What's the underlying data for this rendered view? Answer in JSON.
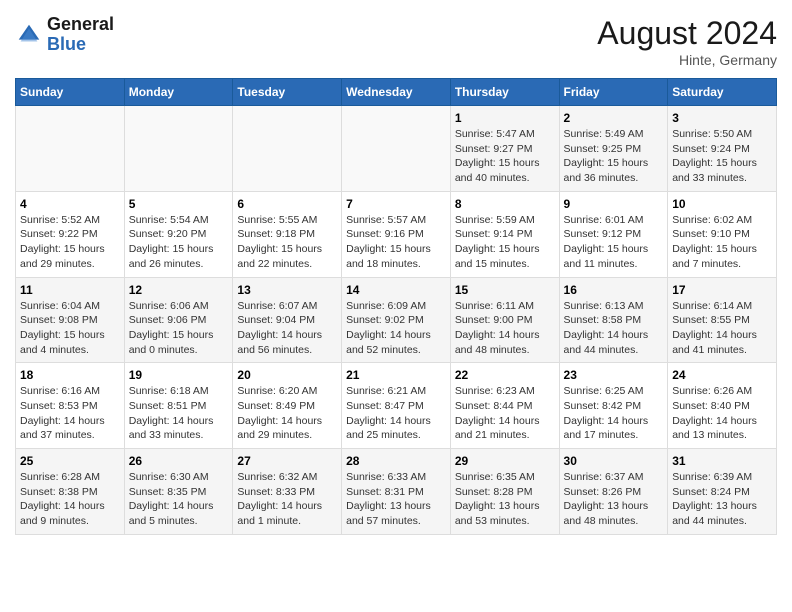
{
  "header": {
    "logo_general": "General",
    "logo_blue": "Blue",
    "month_year": "August 2024",
    "location": "Hinte, Germany"
  },
  "weekdays": [
    "Sunday",
    "Monday",
    "Tuesday",
    "Wednesday",
    "Thursday",
    "Friday",
    "Saturday"
  ],
  "weeks": [
    [
      {
        "day": "",
        "info": ""
      },
      {
        "day": "",
        "info": ""
      },
      {
        "day": "",
        "info": ""
      },
      {
        "day": "",
        "info": ""
      },
      {
        "day": "1",
        "info": "Sunrise: 5:47 AM\nSunset: 9:27 PM\nDaylight: 15 hours\nand 40 minutes."
      },
      {
        "day": "2",
        "info": "Sunrise: 5:49 AM\nSunset: 9:25 PM\nDaylight: 15 hours\nand 36 minutes."
      },
      {
        "day": "3",
        "info": "Sunrise: 5:50 AM\nSunset: 9:24 PM\nDaylight: 15 hours\nand 33 minutes."
      }
    ],
    [
      {
        "day": "4",
        "info": "Sunrise: 5:52 AM\nSunset: 9:22 PM\nDaylight: 15 hours\nand 29 minutes."
      },
      {
        "day": "5",
        "info": "Sunrise: 5:54 AM\nSunset: 9:20 PM\nDaylight: 15 hours\nand 26 minutes."
      },
      {
        "day": "6",
        "info": "Sunrise: 5:55 AM\nSunset: 9:18 PM\nDaylight: 15 hours\nand 22 minutes."
      },
      {
        "day": "7",
        "info": "Sunrise: 5:57 AM\nSunset: 9:16 PM\nDaylight: 15 hours\nand 18 minutes."
      },
      {
        "day": "8",
        "info": "Sunrise: 5:59 AM\nSunset: 9:14 PM\nDaylight: 15 hours\nand 15 minutes."
      },
      {
        "day": "9",
        "info": "Sunrise: 6:01 AM\nSunset: 9:12 PM\nDaylight: 15 hours\nand 11 minutes."
      },
      {
        "day": "10",
        "info": "Sunrise: 6:02 AM\nSunset: 9:10 PM\nDaylight: 15 hours\nand 7 minutes."
      }
    ],
    [
      {
        "day": "11",
        "info": "Sunrise: 6:04 AM\nSunset: 9:08 PM\nDaylight: 15 hours\nand 4 minutes."
      },
      {
        "day": "12",
        "info": "Sunrise: 6:06 AM\nSunset: 9:06 PM\nDaylight: 15 hours\nand 0 minutes."
      },
      {
        "day": "13",
        "info": "Sunrise: 6:07 AM\nSunset: 9:04 PM\nDaylight: 14 hours\nand 56 minutes."
      },
      {
        "day": "14",
        "info": "Sunrise: 6:09 AM\nSunset: 9:02 PM\nDaylight: 14 hours\nand 52 minutes."
      },
      {
        "day": "15",
        "info": "Sunrise: 6:11 AM\nSunset: 9:00 PM\nDaylight: 14 hours\nand 48 minutes."
      },
      {
        "day": "16",
        "info": "Sunrise: 6:13 AM\nSunset: 8:58 PM\nDaylight: 14 hours\nand 44 minutes."
      },
      {
        "day": "17",
        "info": "Sunrise: 6:14 AM\nSunset: 8:55 PM\nDaylight: 14 hours\nand 41 minutes."
      }
    ],
    [
      {
        "day": "18",
        "info": "Sunrise: 6:16 AM\nSunset: 8:53 PM\nDaylight: 14 hours\nand 37 minutes."
      },
      {
        "day": "19",
        "info": "Sunrise: 6:18 AM\nSunset: 8:51 PM\nDaylight: 14 hours\nand 33 minutes."
      },
      {
        "day": "20",
        "info": "Sunrise: 6:20 AM\nSunset: 8:49 PM\nDaylight: 14 hours\nand 29 minutes."
      },
      {
        "day": "21",
        "info": "Sunrise: 6:21 AM\nSunset: 8:47 PM\nDaylight: 14 hours\nand 25 minutes."
      },
      {
        "day": "22",
        "info": "Sunrise: 6:23 AM\nSunset: 8:44 PM\nDaylight: 14 hours\nand 21 minutes."
      },
      {
        "day": "23",
        "info": "Sunrise: 6:25 AM\nSunset: 8:42 PM\nDaylight: 14 hours\nand 17 minutes."
      },
      {
        "day": "24",
        "info": "Sunrise: 6:26 AM\nSunset: 8:40 PM\nDaylight: 14 hours\nand 13 minutes."
      }
    ],
    [
      {
        "day": "25",
        "info": "Sunrise: 6:28 AM\nSunset: 8:38 PM\nDaylight: 14 hours\nand 9 minutes."
      },
      {
        "day": "26",
        "info": "Sunrise: 6:30 AM\nSunset: 8:35 PM\nDaylight: 14 hours\nand 5 minutes."
      },
      {
        "day": "27",
        "info": "Sunrise: 6:32 AM\nSunset: 8:33 PM\nDaylight: 14 hours\nand 1 minute."
      },
      {
        "day": "28",
        "info": "Sunrise: 6:33 AM\nSunset: 8:31 PM\nDaylight: 13 hours\nand 57 minutes."
      },
      {
        "day": "29",
        "info": "Sunrise: 6:35 AM\nSunset: 8:28 PM\nDaylight: 13 hours\nand 53 minutes."
      },
      {
        "day": "30",
        "info": "Sunrise: 6:37 AM\nSunset: 8:26 PM\nDaylight: 13 hours\nand 48 minutes."
      },
      {
        "day": "31",
        "info": "Sunrise: 6:39 AM\nSunset: 8:24 PM\nDaylight: 13 hours\nand 44 minutes."
      }
    ]
  ]
}
